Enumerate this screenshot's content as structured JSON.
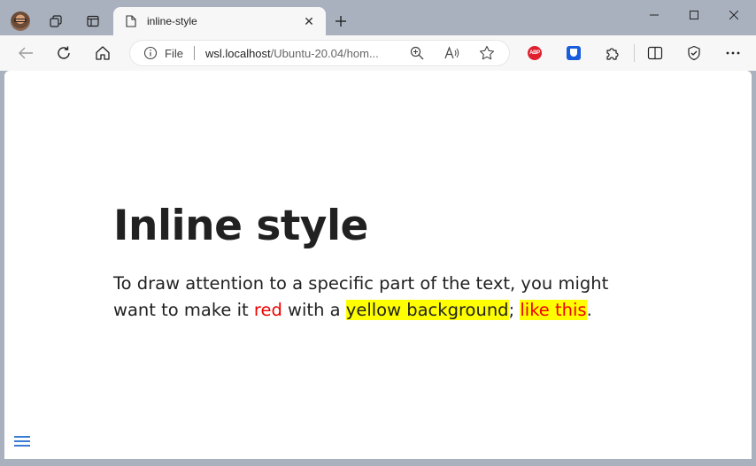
{
  "browser": {
    "tab_title": "inline-style",
    "address": {
      "scheme_label": "File",
      "host": "wsl.localhost",
      "path": "/Ubuntu-20.04/hom..."
    },
    "extensions": {
      "adblock_label": "ABP"
    }
  },
  "page": {
    "heading": "Inline style",
    "paragraph": {
      "part1": "To draw attention to a specific part of the text, you might want to make it ",
      "red_text": "red",
      "part2": " with a ",
      "yellow_text": "yellow background",
      "part3": "; ",
      "both_text": "like this",
      "part4": "."
    }
  },
  "colors": {
    "highlight_red": "#ee0000",
    "highlight_yellow": "#ffff00",
    "menu_icon": "#3a7bd5"
  }
}
